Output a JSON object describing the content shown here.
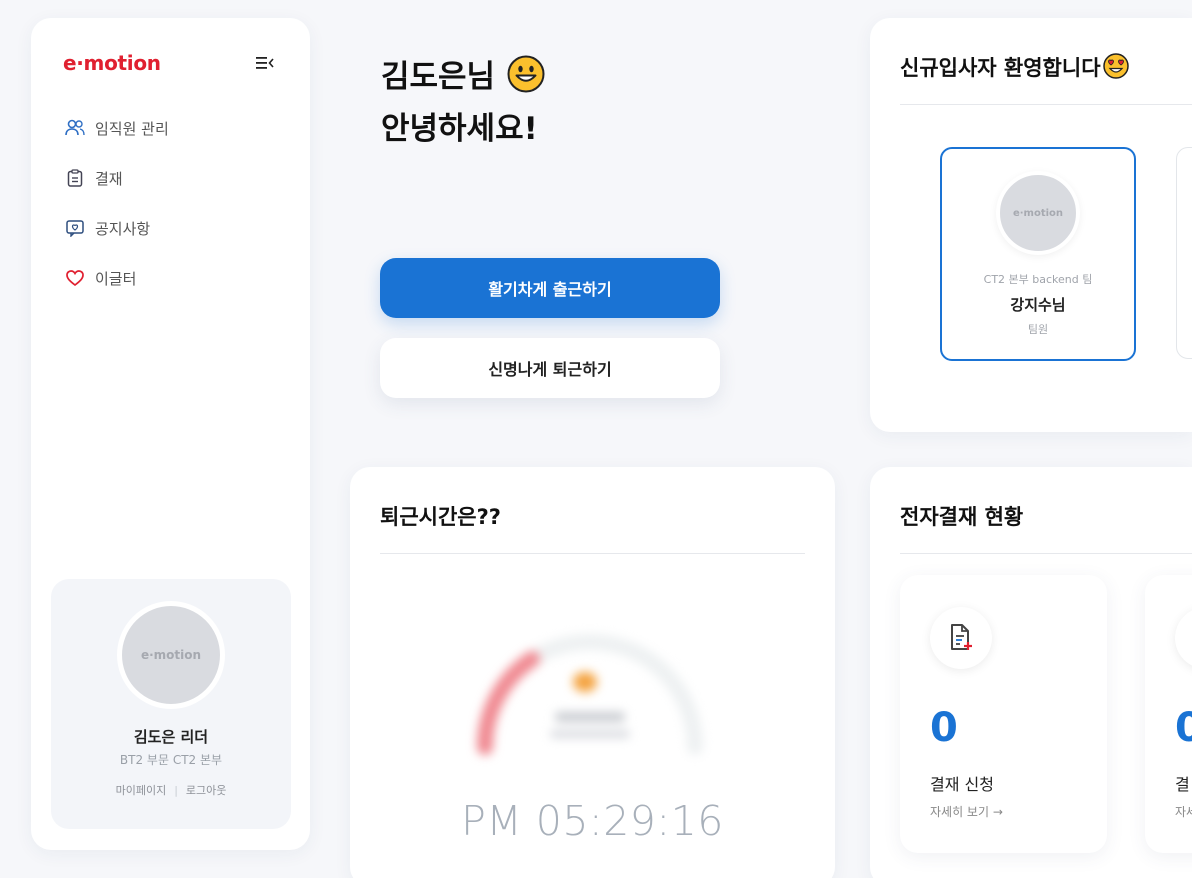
{
  "brand": {
    "logo": "e·motion",
    "accent": "#1a73d4",
    "brand_red": "#e02030"
  },
  "sidebar": {
    "toggle_icon": "menu-collapse-icon",
    "items": [
      {
        "label": "임직원 관리",
        "icon": "users-icon"
      },
      {
        "label": "결재",
        "icon": "clipboard-icon"
      },
      {
        "label": "공지사항",
        "icon": "notice-icon"
      },
      {
        "label": "이글터",
        "icon": "heart-icon"
      }
    ],
    "profile": {
      "avatar_text": "e·motion",
      "name": "김도은 리더",
      "dept": "BT2 부문 CT2 본부",
      "mypage": "마이페이지",
      "logout": "로그아웃"
    }
  },
  "greeting": {
    "line1": "김도은님",
    "line2": "안녕하세요!"
  },
  "actions": {
    "clock_in": "활기차게 출근하기",
    "clock_out": "신명나게 퇴근하기"
  },
  "welcome": {
    "title": "신규입사자 환영합니다",
    "newcomer": {
      "avatar_text": "e·motion",
      "team": "CT2 본부 backend 팀",
      "name": "강지수님",
      "role": "팀원"
    }
  },
  "time": {
    "title": "퇴근시간은??",
    "clock": "PM 05:29:16"
  },
  "approval": {
    "title": "전자결재 현황",
    "items": [
      {
        "count": "0",
        "label": "결재 신청",
        "more": "자세히 보기 →"
      },
      {
        "count": "0",
        "label": "결",
        "more": "자세"
      }
    ]
  }
}
